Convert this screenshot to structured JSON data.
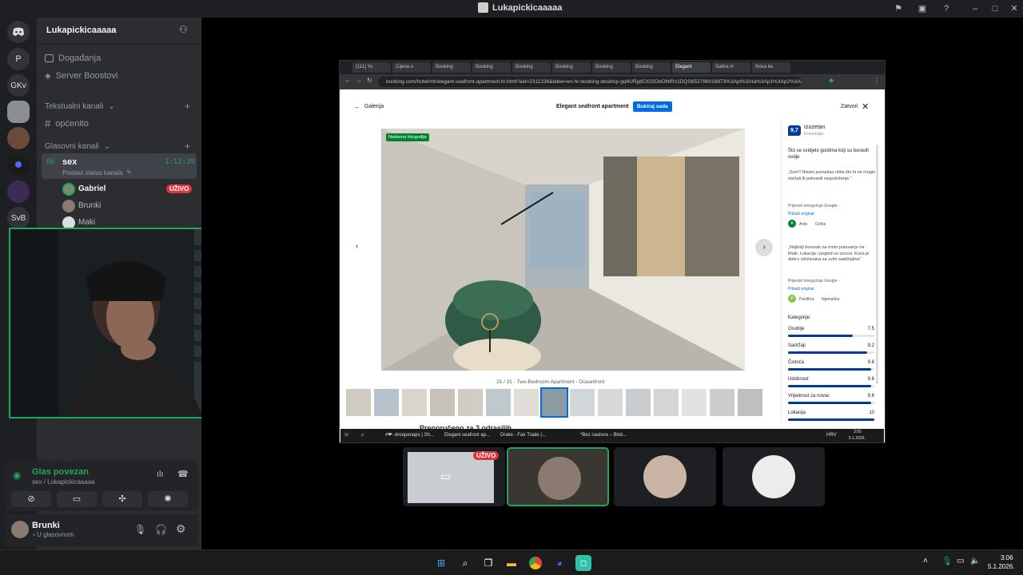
{
  "window": {
    "title": "Lukapickicaaaaa"
  },
  "servers": {
    "items": [
      "P",
      "GKv",
      "SvB"
    ]
  },
  "guild": {
    "name": "Lukapickicaaaaa",
    "events": "Događanja",
    "boosts": "Server Boostovi",
    "text_category": "Tekstualni kanali",
    "text_channel": "općenito",
    "voice_category": "Glasovni kanali",
    "voice_channel": "sex",
    "voice_timer": "1:12:39",
    "voice_status": "Postavi status kanala",
    "members": [
      {
        "name": "Gabriel",
        "badge": "UŽIVO"
      },
      {
        "name": "Brunki"
      },
      {
        "name": "Maki"
      }
    ]
  },
  "voice_panel": {
    "status": "Glas povezan",
    "location": "sex / Lukapickicaaaaa"
  },
  "user_panel": {
    "name": "Brunki",
    "status": "U glasovnom"
  },
  "browser": {
    "tabs": [
      "(111) Yo",
      "Cijena o",
      "Booking",
      "Booking",
      "Booking",
      "Booking",
      "Booking",
      "Booking",
      "Elegant",
      "Salina H",
      "Nova ka"
    ],
    "url": "booking.com/hotel/mt/elegant-seafront-apartment.hr.html?aid=2311236&label=en-hr-booking-desktop-gq4URjqfCIGSDbONtRz1DQS652796016873%3Apl%3Ata%3Ap1%3Ap2%3Ac%3A"
  },
  "gallery": {
    "back_label": "Galerija",
    "title": "Elegant seafront apartment",
    "book_button": "Bukiraj sada",
    "close_label": "Zatvori",
    "recent_badge": "Nedavna fotografija",
    "caption": "15 / 31 - Two-Bedroom Apartment - Oceanfront",
    "below_text": "Preporučeno za 3 odrasilih"
  },
  "reviews": {
    "score": "9,7",
    "rating_label": "Izuzetan",
    "review_count": "8 recenzija",
    "liked_heading": "Što se svidjelo gostima koji su boravili ovdje",
    "review1_text": "„Sve!!! Nisam pronašao ništa što bi mi moglo otežati ili pokvariti raspoloženje.\"",
    "translated_by": "Prijevod omogućuje Google -",
    "show_original": "Prikaži original",
    "review1_author": "Ante",
    "review1_country": "Grčka",
    "review2_text": "„Najbolji boravak na mom putovanju na Malti. Lokacija i pogled su izvrsni. Kuća je dobro održavana sa svim sadržajima\"",
    "review2_author": "Pavithra",
    "review2_country": "Njemačka",
    "categories_heading": "Kategorije:",
    "categories": [
      {
        "label": "Osoblje",
        "value": "7.5",
        "fraction": 0.75
      },
      {
        "label": "Sadržaji",
        "value": "9.2",
        "fraction": 0.92
      },
      {
        "label": "Čistoća",
        "value": "9.6",
        "fraction": 0.96
      },
      {
        "label": "Udobnost",
        "value": "9.6",
        "fraction": 0.96
      },
      {
        "label": "Vrijednost za novac",
        "value": "9.6",
        "fraction": 0.96
      },
      {
        "label": "Lokacija",
        "value": "10",
        "fraction": 1.0
      }
    ]
  },
  "shared_taskbar": {
    "items": [
      "#❤- droopenaps | Sh...",
      "Elegant seafront ap...",
      "Drake - Fair Trade (...",
      "*Bez naslova – Blok..."
    ],
    "lang": "HRV",
    "clock_time": "3:05",
    "clock_date": "5.1.2026."
  },
  "stream_tiles": {
    "live_badge": "UŽIVO"
  },
  "taskbar": {
    "clock_time": "3:06",
    "clock_date": "5.1.2026."
  },
  "colors": {
    "discord_green": "#23a55a",
    "booking_blue": "#003b95",
    "live_red": "#da373c"
  }
}
